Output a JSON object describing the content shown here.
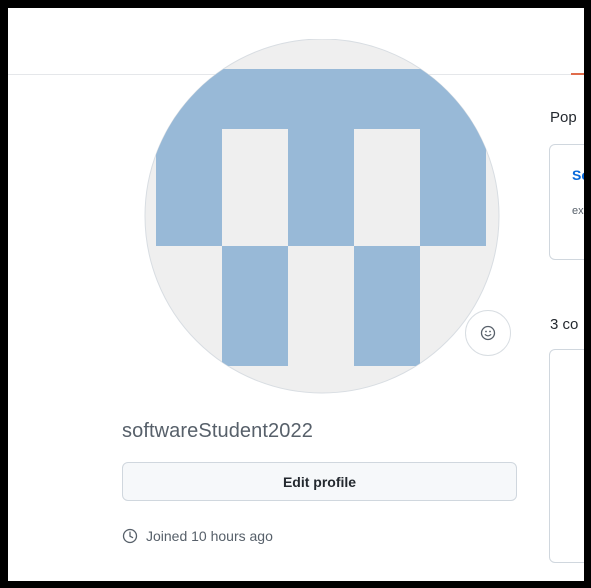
{
  "profile": {
    "username": "softwareStudent2022",
    "edit_button_label": "Edit profile",
    "joined_text": "Joined 10 hours ago"
  },
  "popular": {
    "heading": "Pop",
    "repo_name": "Sc",
    "repo_desc": "ex"
  },
  "contributions": {
    "heading": "3 co"
  },
  "icons": {
    "avatar": "identicon-avatar",
    "status": "smiley-icon",
    "joined": "clock-icon"
  },
  "colors": {
    "identicon": "#98b9d7",
    "avatar_bg": "#efefef",
    "link": "#0969da",
    "accent": "#e06c4b"
  }
}
